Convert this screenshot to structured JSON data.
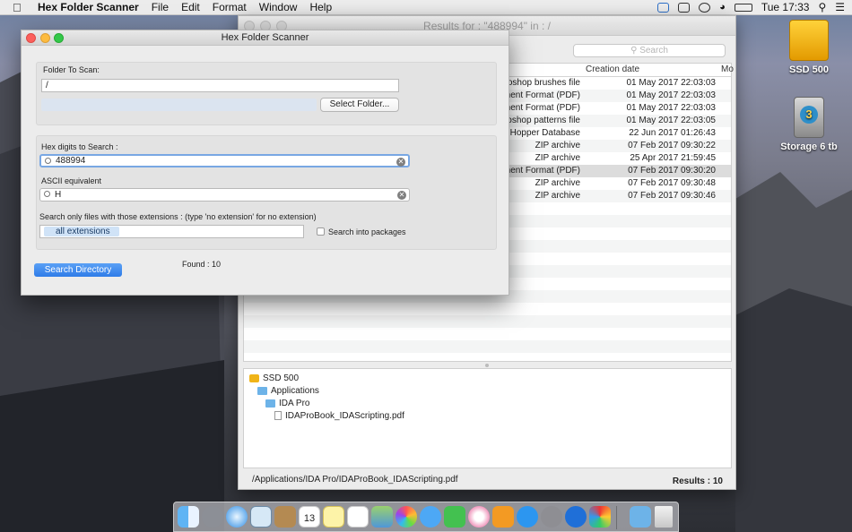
{
  "menubar": {
    "app_name": "Hex Folder Scanner",
    "menus": [
      "File",
      "Edit",
      "Format",
      "Window",
      "Help"
    ],
    "clock": "Tue 17:33"
  },
  "desktop": {
    "icons": [
      {
        "label": "SSD 500",
        "color": "#f0b418"
      },
      {
        "label": "Storage 6 tb",
        "color": "#3a9a7a"
      }
    ]
  },
  "results_window": {
    "title": "Results for : \"488994\" in : /",
    "search_placeholder": "Search",
    "columns": {
      "creation_date": "Creation date",
      "modified": "Mo"
    },
    "rows": [
      {
        "kind": "otoshop brushes file",
        "date": "01 May 2017 22:03:03"
      },
      {
        "kind": "ument Format (PDF)",
        "date": "01 May 2017 22:03:03"
      },
      {
        "kind": "ument Format (PDF)",
        "date": "01 May 2017 22:03:03"
      },
      {
        "kind": "otoshop patterns file",
        "date": "01 May 2017 22:03:05"
      },
      {
        "kind": "Hopper Database",
        "date": "22 Jun 2017 01:26:43"
      },
      {
        "kind": "ZIP archive",
        "date": "07 Feb 2017 09:30:22"
      },
      {
        "kind": "ZIP archive",
        "date": "25 Apr 2017 21:59:45"
      },
      {
        "kind": "ument Format (PDF)",
        "date": "07 Feb 2017 09:30:20"
      },
      {
        "kind": "ZIP archive",
        "date": "07 Feb 2017 09:30:48"
      },
      {
        "kind": "ZIP archive",
        "date": "07 Feb 2017 09:30:46"
      }
    ],
    "tree": [
      "SSD 500",
      "Applications",
      "IDA Pro",
      "IDAProBook_IDAScripting.pdf"
    ],
    "status_path": "/Applications/IDA Pro/IDAProBook_IDAScripting.pdf",
    "results_count": "Results : 10"
  },
  "scanner_window": {
    "title": "Hex Folder Scanner",
    "folder_label": "Folder To Scan:",
    "folder_value": "/",
    "select_folder_button": "Select Folder...",
    "hex_label": "Hex digits to Search :",
    "hex_value": "488994",
    "ascii_label": "ASCII equivalent",
    "ascii_value": "H",
    "ext_label": "Search only files with those extensions : (type 'no extension' for no extension)",
    "ext_token": "all extensions",
    "packages_label": "Search into packages",
    "search_button": "Search Directory",
    "found": "Found : 10"
  },
  "dock": {
    "items": [
      "finder-icon",
      "launchpad-icon",
      "safari-icon",
      "preview-icon",
      "contacts-icon",
      "calendar-icon",
      "notes-icon",
      "reminders-icon",
      "photo-icon",
      "photos-icon",
      "messages-icon",
      "facetime-icon",
      "music-icon",
      "books-icon",
      "appstore-icon",
      "system-preferences-icon",
      "teamviewer-icon",
      "hex-scanner-icon",
      "downloads-folder-icon",
      "trash-icon"
    ],
    "calendar_day": "13"
  }
}
